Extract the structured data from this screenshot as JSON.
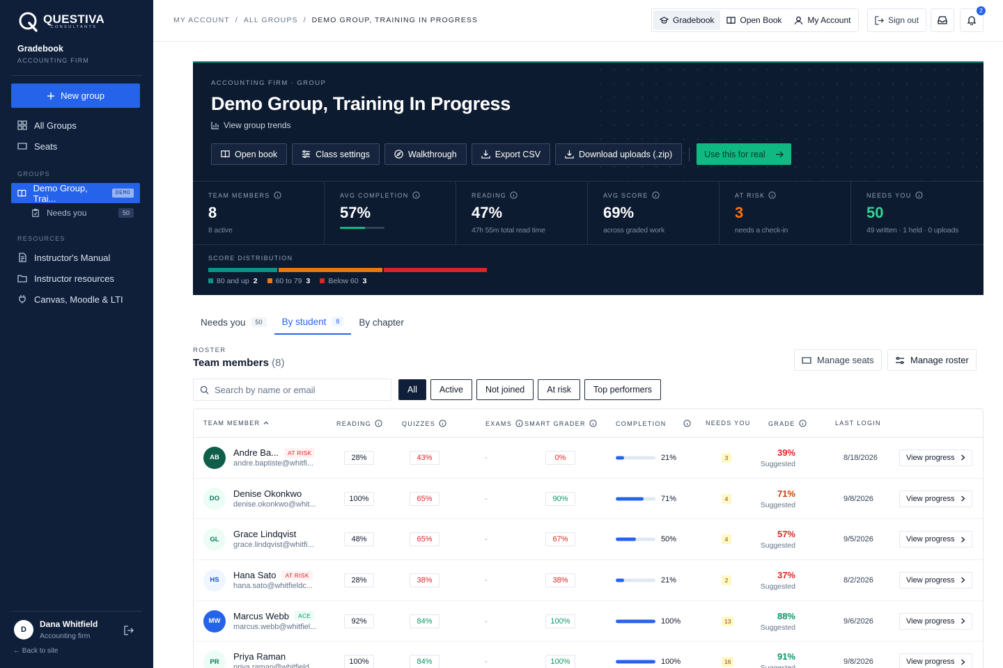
{
  "brand": {
    "name": "QUESTIVA",
    "sub": "CONSULTANTS"
  },
  "sidebar": {
    "title": "Gradebook",
    "subtitle": "ACCOUNTING FIRM",
    "new_group": "New group",
    "nav": [
      {
        "label": "All Groups",
        "icon": "grid-icon"
      },
      {
        "label": "Seats",
        "icon": "ticket-icon"
      }
    ],
    "groups_heading": "GROUPS",
    "active_group": {
      "label": "Demo Group, Trai...",
      "badge": "DEMO"
    },
    "needs_you": {
      "label": "Needs you",
      "count": "50"
    },
    "resources_heading": "RESOURCES",
    "resources": [
      {
        "label": "Instructor's Manual"
      },
      {
        "label": "Instructor resources"
      },
      {
        "label": "Canvas, Moodle & LTI"
      }
    ],
    "user": {
      "initial": "D",
      "name": "Dana Whitfield",
      "role": "Accounting firm"
    },
    "back": "← Back to site"
  },
  "topbar": {
    "breadcrumb": [
      "MY ACCOUNT",
      "/",
      "ALL GROUPS",
      "/",
      "DEMO GROUP, TRAINING IN PROGRESS"
    ],
    "buttons": [
      "Gradebook",
      "Open Book",
      "My Account"
    ],
    "sign_out": "Sign out",
    "notifications": "2"
  },
  "hero": {
    "eyebrow": "ACCOUNTING FIRM · GROUP",
    "title": "Demo Group, Training In Progress",
    "trends": "View group trends",
    "actions": [
      "Open book",
      "Class settings",
      "Walkthrough",
      "Export CSV",
      "Download uploads (.zip)"
    ],
    "cta": "Use this for real",
    "stats": [
      {
        "label": "TEAM MEMBERS",
        "value": "8",
        "sub": "8 active",
        "color": "#ffffff"
      },
      {
        "label": "AVG COMPLETION",
        "value": "57%",
        "sub": "",
        "progress": 57,
        "color": "#ffffff"
      },
      {
        "label": "READING",
        "value": "47%",
        "sub": "47h 55m total read time",
        "color": "#ffffff"
      },
      {
        "label": "AVG SCORE",
        "value": "69%",
        "sub": "across graded work",
        "color": "#ffffff"
      },
      {
        "label": "AT RISK",
        "value": "3",
        "sub": "needs a check-in",
        "color": "#f97316"
      },
      {
        "label": "NEEDS YOU",
        "value": "50",
        "sub": "49 written · 1 held · 0 uploads",
        "color": "#34d399"
      }
    ],
    "distribution": {
      "label": "SCORE DISTRIBUTION",
      "buckets": [
        {
          "label": "80 and up",
          "count": "2",
          "value": 2,
          "color": "#0d9488"
        },
        {
          "label": "60 to 79",
          "count": "3",
          "value": 3,
          "color": "#ea7a12"
        },
        {
          "label": "Below 60",
          "count": "3",
          "value": 3,
          "color": "#dc2626"
        }
      ]
    }
  },
  "tabs": [
    {
      "label": "Needs you",
      "count": "50"
    },
    {
      "label": "By student",
      "count": "8"
    },
    {
      "label": "By chapter",
      "count": ""
    }
  ],
  "roster": {
    "eyebrow": "ROSTER",
    "title": "Team members",
    "count": "(8)",
    "manage_seats": "Manage seats",
    "manage_roster": "Manage roster",
    "search_placeholder": "Search by name or email",
    "filters": [
      "All",
      "Active",
      "Not joined",
      "At risk",
      "Top performers"
    ]
  },
  "table": {
    "headers": [
      "TEAM MEMBER",
      "READING",
      "QUIZZES",
      "EXAMS",
      "SMART GRADER",
      "COMPLETION",
      "NEEDS YOU",
      "GRADE",
      "LAST LOGIN"
    ],
    "view_label": "View progress",
    "rows": [
      {
        "initials": "AB",
        "name": "Andre Ba...",
        "tag": "AT RISK",
        "tag_type": "risk",
        "email": "andre.baptiste@whitfi...",
        "reading": "28%",
        "quizzes": "43%",
        "quiz_tone": "red",
        "exams": "-",
        "smart": "0%",
        "smart_tone": "red",
        "completion": "21%",
        "comp_val": 21,
        "needs": "3",
        "grade": "39%",
        "grade_color": "#dc2626",
        "suggest": "Suggested",
        "login": "8/18/2026",
        "ava_bg": "#0f5e4a",
        "ava_fg": "#ffffff"
      },
      {
        "initials": "DO",
        "name": "Denise Okonkwo",
        "tag": "",
        "tag_type": "",
        "email": "denise.okonkwo@whit...",
        "reading": "100%",
        "quizzes": "65%",
        "quiz_tone": "red",
        "exams": "-",
        "smart": "90%",
        "smart_tone": "green",
        "completion": "71%",
        "comp_val": 71,
        "needs": "4",
        "grade": "71%",
        "grade_color": "#c2410c",
        "suggest": "Suggested",
        "login": "9/8/2026",
        "ava_bg": "#ecfdf5",
        "ava_fg": "#047857"
      },
      {
        "initials": "GL",
        "name": "Grace Lindqvist",
        "tag": "",
        "tag_type": "",
        "email": "grace.lindqvist@whitfi...",
        "reading": "48%",
        "quizzes": "65%",
        "quiz_tone": "red",
        "exams": "-",
        "smart": "67%",
        "smart_tone": "red",
        "completion": "50%",
        "comp_val": 50,
        "needs": "4",
        "grade": "57%",
        "grade_color": "#dc2626",
        "suggest": "Suggested",
        "login": "9/5/2026",
        "ava_bg": "#ecfdf5",
        "ava_fg": "#047857"
      },
      {
        "initials": "HS",
        "name": "Hana Sato",
        "tag": "AT RISK",
        "tag_type": "risk",
        "email": "hana.sato@whitfieldc...",
        "reading": "28%",
        "quizzes": "38%",
        "quiz_tone": "red",
        "exams": "-",
        "smart": "38%",
        "smart_tone": "red",
        "completion": "21%",
        "comp_val": 21,
        "needs": "2",
        "grade": "37%",
        "grade_color": "#dc2626",
        "suggest": "Suggested",
        "login": "8/2/2026",
        "ava_bg": "#eff6ff",
        "ava_fg": "#1d4ed8"
      },
      {
        "initials": "MW",
        "name": "Marcus Webb",
        "tag": "ACE",
        "tag_type": "ace",
        "email": "marcus.webb@whitfiel...",
        "reading": "92%",
        "quizzes": "84%",
        "quiz_tone": "green",
        "exams": "-",
        "smart": "100%",
        "smart_tone": "green",
        "completion": "100%",
        "comp_val": 100,
        "needs": "13",
        "grade": "88%",
        "grade_color": "#059669",
        "suggest": "Suggested",
        "login": "9/6/2026",
        "ava_bg": "#2563eb",
        "ava_fg": "#ffffff"
      },
      {
        "initials": "PR",
        "name": "Priya Raman",
        "tag": "",
        "tag_type": "",
        "email": "priya.raman@whitfield...",
        "reading": "100%",
        "quizzes": "84%",
        "quiz_tone": "green",
        "exams": "-",
        "smart": "100%",
        "smart_tone": "green",
        "completion": "100%",
        "comp_val": 100,
        "needs": "16",
        "grade": "91%",
        "grade_color": "#059669",
        "suggest": "Suggested",
        "login": "9/8/2026",
        "ava_bg": "#ecfdf5",
        "ava_fg": "#047857"
      }
    ]
  }
}
